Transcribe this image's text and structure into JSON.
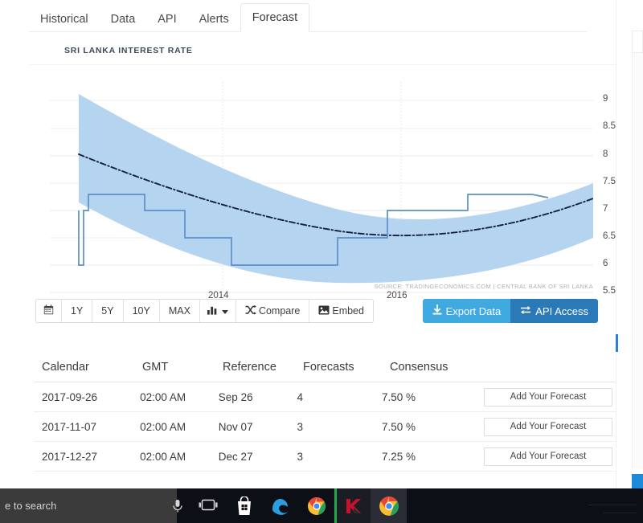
{
  "tabs": [
    {
      "label": "Historical",
      "active": false
    },
    {
      "label": "Data",
      "active": false
    },
    {
      "label": "API",
      "active": false
    },
    {
      "label": "Alerts",
      "active": false
    },
    {
      "label": "Forecast",
      "active": true
    }
  ],
  "chart": {
    "title": "SRI LANKA INTEREST RATE",
    "source": "SOURCE: TRADINGECONOMICS.COM  |  CENTRAL BANK OF SRI LANKA"
  },
  "chart_data": {
    "type": "line",
    "title": "SRI LANKA INTEREST RATE",
    "xlabel": "",
    "ylabel": "",
    "ylim": [
      5.5,
      9
    ],
    "yticks": [
      "5.5",
      "6",
      "6.5",
      "7",
      "7.5",
      "8",
      "8.5",
      "9"
    ],
    "xticks": [
      "2014",
      "2016"
    ],
    "grid": true,
    "legend": "none",
    "colors": {
      "line": "#5b8fc9",
      "band": "#aed0ef",
      "trend": "#1b2b4b"
    },
    "series": [
      {
        "name": "Interest Rate (step)",
        "style": "step",
        "x": [
          2013.0,
          2013.05,
          2013.35,
          2013.95,
          2014.45,
          2014.95,
          2015.65,
          2016.35,
          2016.85,
          2017.35,
          2017.65,
          2017.95
        ],
        "values": [
          6.5,
          7.0,
          7.25,
          7.0,
          6.75,
          6.5,
          6.25,
          6.5,
          6.75,
          7.25,
          7.5,
          7.45
        ]
      },
      {
        "name": "Forecast trend",
        "style": "dash-dot",
        "x": [
          2013.0,
          2013.5,
          2014.0,
          2014.5,
          2015.0,
          2015.5,
          2016.0,
          2016.5,
          2017.0,
          2017.5,
          2018.0
        ],
        "values": [
          7.95,
          7.55,
          7.2,
          6.92,
          6.7,
          6.55,
          6.48,
          6.5,
          6.62,
          6.9,
          7.35
        ]
      },
      {
        "name": "Confidence band upper",
        "style": "band",
        "x": [
          2013.0,
          2013.5,
          2014.0,
          2014.5,
          2015.0,
          2015.5,
          2016.0,
          2016.5,
          2017.0,
          2017.5,
          2018.0
        ],
        "values": [
          8.72,
          8.3,
          7.95,
          7.62,
          7.38,
          7.2,
          7.12,
          7.18,
          7.35,
          7.65,
          8.0
        ]
      },
      {
        "name": "Confidence band lower",
        "style": "band",
        "x": [
          2013.0,
          2013.5,
          2014.0,
          2014.5,
          2015.0,
          2015.5,
          2016.0,
          2016.5,
          2017.0,
          2017.5,
          2018.0
        ],
        "values": [
          7.1,
          6.72,
          6.42,
          6.18,
          6.02,
          5.9,
          5.88,
          5.92,
          6.05,
          6.32,
          6.75
        ]
      }
    ]
  },
  "toolbar": {
    "range_buttons": [
      {
        "label": "",
        "icon": "calendar-icon"
      },
      {
        "label": "1Y",
        "icon": ""
      },
      {
        "label": "5Y",
        "icon": ""
      },
      {
        "label": "10Y",
        "icon": ""
      },
      {
        "label": "MAX",
        "icon": ""
      },
      {
        "label": "",
        "icon": "bar-chart-dropdown-icon"
      },
      {
        "label": "Compare",
        "icon": "shuffle-icon"
      },
      {
        "label": "Embed",
        "icon": "image-icon"
      }
    ],
    "export_label": "Export Data",
    "api_label": "API Access",
    "colors": {
      "export": "#3fa9e0",
      "api": "#2b7ab8"
    }
  },
  "table": {
    "headers": [
      "Calendar",
      "GMT",
      "Reference",
      "Forecasts",
      "Consensus",
      ""
    ],
    "rows": [
      {
        "calendar": "2017-09-26",
        "gmt": "02:00 AM",
        "reference": "Sep 26",
        "forecasts": "4",
        "consensus": "7.50 %",
        "action": "Add Your Forecast"
      },
      {
        "calendar": "2017-11-07",
        "gmt": "02:00 AM",
        "reference": "Nov 07",
        "forecasts": "3",
        "consensus": "7.50 %",
        "action": "Add Your Forecast"
      },
      {
        "calendar": "2017-12-27",
        "gmt": "02:00 AM",
        "reference": "Dec 27",
        "forecasts": "3",
        "consensus": "7.25 %",
        "action": "Add Your Forecast"
      }
    ]
  },
  "taskbar": {
    "search_text": "e to search",
    "items": [
      {
        "name": "cortana-mic-icon"
      },
      {
        "name": "task-view-icon"
      },
      {
        "name": "microsoft-store-icon"
      },
      {
        "name": "edge-browser-icon"
      },
      {
        "name": "chrome-browser-icon"
      },
      {
        "name": "kaspersky-icon"
      },
      {
        "name": "chrome-browser-active-icon"
      }
    ]
  }
}
